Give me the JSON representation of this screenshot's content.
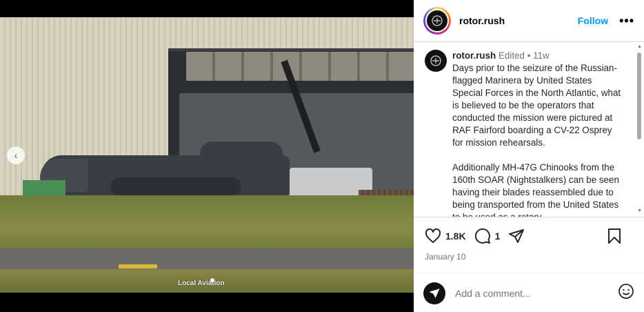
{
  "post": {
    "username": "rotor.rush",
    "follow_label": "Follow",
    "more_label": "•••",
    "watermark": "Local Aviation",
    "caption": {
      "edited": "Edited",
      "separator": "•",
      "age": "11w",
      "paragraph1": "Days prior to the seizure of the Russian-flagged Marinera by United States Special Forces in the North Atlantic, what is believed to be the operators that conducted the mission were pictured at RAF Fairford boarding a CV-22 Osprey for mission rehearsals.",
      "paragraph2": "Additionally MH-47G Chinooks from the 160th SOAR (Nightstalkers) can be seen having their blades reassembled due to being transported from the United States to be used as a rotary"
    },
    "likes": "1.8K",
    "comments_count": "1",
    "date": "January 10",
    "comment_placeholder": "Add a comment..."
  },
  "colors": {
    "follow_blue": "#0095f6",
    "meta_gray": "#737373"
  },
  "icons": {
    "prev": "chevron-left-icon",
    "like": "heart-icon",
    "comment": "comment-icon",
    "share": "paper-plane-icon",
    "save": "bookmark-icon",
    "emoji": "smiley-icon"
  }
}
